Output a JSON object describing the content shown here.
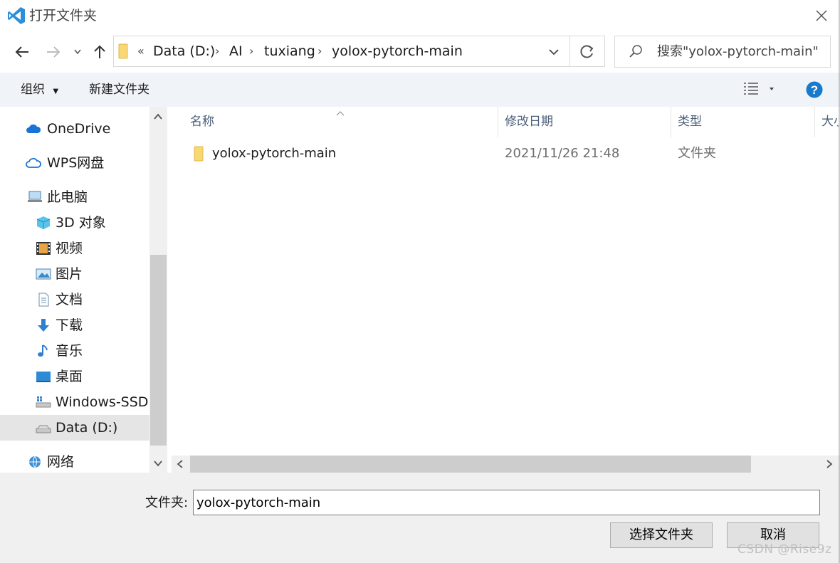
{
  "window": {
    "title": "打开文件夹"
  },
  "address": {
    "overflow_glyph": "«",
    "crumbs": [
      "Data (D:)",
      "AI",
      "tuxiang",
      "yolox-pytorch-main"
    ]
  },
  "search": {
    "placeholder": "搜索\"yolox-pytorch-main\""
  },
  "toolbar": {
    "organize_label": "组织",
    "new_folder_label": "新建文件夹"
  },
  "sidebar": {
    "items": [
      {
        "label": "OneDrive",
        "icon": "cloud-icon"
      },
      {
        "label": "WPS网盘",
        "icon": "cloud-outline-icon"
      },
      {
        "label": "此电脑",
        "icon": "computer-icon"
      },
      {
        "label": "3D 对象",
        "icon": "cube-icon"
      },
      {
        "label": "视频",
        "icon": "film-icon"
      },
      {
        "label": "图片",
        "icon": "picture-icon"
      },
      {
        "label": "文档",
        "icon": "document-icon"
      },
      {
        "label": "下载",
        "icon": "download-arrow-icon"
      },
      {
        "label": "音乐",
        "icon": "music-note-icon"
      },
      {
        "label": "桌面",
        "icon": "desktop-icon"
      },
      {
        "label": "Windows-SSD (",
        "icon": "drive-icon"
      },
      {
        "label": "Data (D:)",
        "icon": "drive-icon",
        "selected": true
      },
      {
        "label": "网络",
        "icon": "network-icon"
      }
    ]
  },
  "file_list": {
    "columns": [
      "名称",
      "修改日期",
      "类型",
      "大小"
    ],
    "rows": [
      {
        "name": "yolox-pytorch-main",
        "modified": "2021/11/26 21:48",
        "type": "文件夹"
      }
    ]
  },
  "bottom": {
    "folder_label": "文件夹:",
    "folder_value": "yolox-pytorch-main",
    "select_button": "选择文件夹",
    "cancel_button": "取消"
  },
  "watermark": "CSDN @Rise9z",
  "colors": {
    "accent": "#0063b1",
    "selected_bg": "#e5e5e5",
    "toolbar_bg": "#f0f4f9",
    "folder": "#f8d775",
    "help": "#1979ca"
  }
}
